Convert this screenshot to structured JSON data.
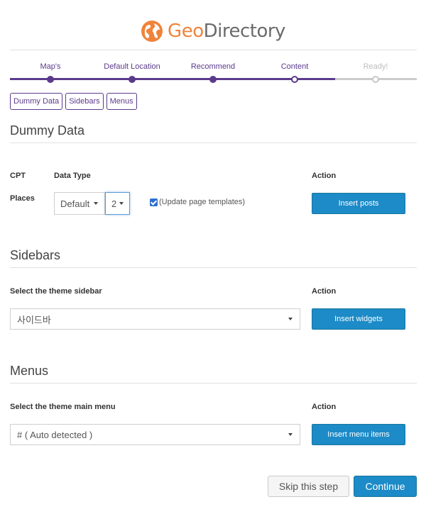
{
  "brand": {
    "geo": "Geo",
    "directory": "Directory",
    "accent": "#f0833a"
  },
  "wizard": {
    "steps": [
      {
        "label": "Map's",
        "state": "done"
      },
      {
        "label": "Default Location",
        "state": "done"
      },
      {
        "label": "Recommend",
        "state": "done"
      },
      {
        "label": "Content",
        "state": "current"
      },
      {
        "label": "Ready!",
        "state": "future"
      }
    ],
    "accent": "#5b3a8c"
  },
  "tabs": [
    "Dummy Data",
    "Sidebars",
    "Menus"
  ],
  "dummy": {
    "title": "Dummy Data",
    "col_cpt": "CPT",
    "col_type": "Data Type",
    "col_action": "Action",
    "row_cpt": "Places",
    "type_value": "Default",
    "count_value": "2",
    "checkbox_label": "(Update page templates)",
    "checkbox_checked": true,
    "button": "Insert posts"
  },
  "sidebars": {
    "title": "Sidebars",
    "label": "Select the theme sidebar",
    "col_action": "Action",
    "value": "사이드바",
    "button": "Insert widgets"
  },
  "menus": {
    "title": "Menus",
    "label": "Select the theme main menu",
    "col_action": "Action",
    "value": "# ( Auto detected )",
    "button": "Insert menu items"
  },
  "footer": {
    "skip": "Skip this step",
    "continue": "Continue"
  },
  "colors": {
    "button_blue": "#1c8bc7"
  }
}
